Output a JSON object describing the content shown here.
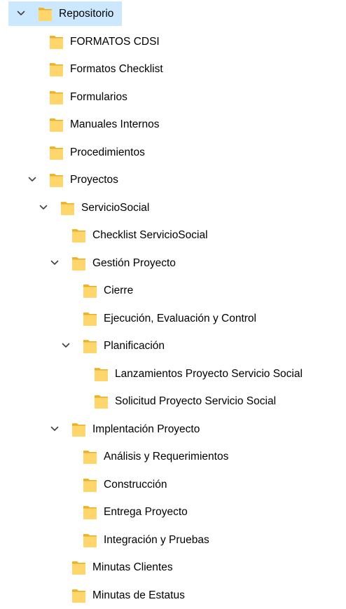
{
  "tree": {
    "items": [
      {
        "label": "Repositorio",
        "level": 0,
        "expanded": true,
        "has_children": true,
        "selected": true
      },
      {
        "label": "FORMATOS CDSI",
        "level": 1,
        "expanded": false,
        "has_children": false,
        "selected": false
      },
      {
        "label": "Formatos Checklist",
        "level": 1,
        "expanded": false,
        "has_children": false,
        "selected": false
      },
      {
        "label": "Formularios",
        "level": 1,
        "expanded": false,
        "has_children": false,
        "selected": false
      },
      {
        "label": "Manuales Internos",
        "level": 1,
        "expanded": false,
        "has_children": false,
        "selected": false
      },
      {
        "label": "Procedimientos",
        "level": 1,
        "expanded": false,
        "has_children": false,
        "selected": false
      },
      {
        "label": "Proyectos",
        "level": 1,
        "expanded": true,
        "has_children": true,
        "selected": false
      },
      {
        "label": "ServicioSocial",
        "level": 2,
        "expanded": true,
        "has_children": true,
        "selected": false
      },
      {
        "label": "Checklist ServicioSocial",
        "level": 3,
        "expanded": false,
        "has_children": false,
        "selected": false
      },
      {
        "label": "Gestión Proyecto",
        "level": 3,
        "expanded": true,
        "has_children": true,
        "selected": false
      },
      {
        "label": "Cierre",
        "level": 4,
        "expanded": false,
        "has_children": false,
        "selected": false
      },
      {
        "label": "Ejecución, Evaluación y Control",
        "level": 4,
        "expanded": false,
        "has_children": false,
        "selected": false
      },
      {
        "label": "Planificación",
        "level": 4,
        "expanded": true,
        "has_children": true,
        "selected": false
      },
      {
        "label": "Lanzamientos Proyecto Servicio Social",
        "level": 5,
        "expanded": false,
        "has_children": false,
        "selected": false
      },
      {
        "label": "Solicitud Proyecto Servicio Social",
        "level": 5,
        "expanded": false,
        "has_children": false,
        "selected": false
      },
      {
        "label": "Implentación Proyecto",
        "level": 3,
        "expanded": true,
        "has_children": true,
        "selected": false
      },
      {
        "label": "Análisis y Requerimientos",
        "level": 4,
        "expanded": false,
        "has_children": false,
        "selected": false
      },
      {
        "label": "Construcción",
        "level": 4,
        "expanded": false,
        "has_children": false,
        "selected": false
      },
      {
        "label": "Entrega Proyecto",
        "level": 4,
        "expanded": false,
        "has_children": false,
        "selected": false
      },
      {
        "label": "Integración y Pruebas",
        "level": 4,
        "expanded": false,
        "has_children": false,
        "selected": false
      },
      {
        "label": "Minutas Clientes",
        "level": 3,
        "expanded": false,
        "has_children": false,
        "selected": false
      },
      {
        "label": "Minutas de Estatus",
        "level": 3,
        "expanded": false,
        "has_children": false,
        "selected": false
      }
    ]
  },
  "icons": {
    "folder": "folder-icon",
    "expand": "chevron-down-icon"
  },
  "colors": {
    "selection": "#cce8ff",
    "folder_fill": "#ffd66b",
    "folder_back": "#f0b428",
    "chevron": "#404040"
  }
}
